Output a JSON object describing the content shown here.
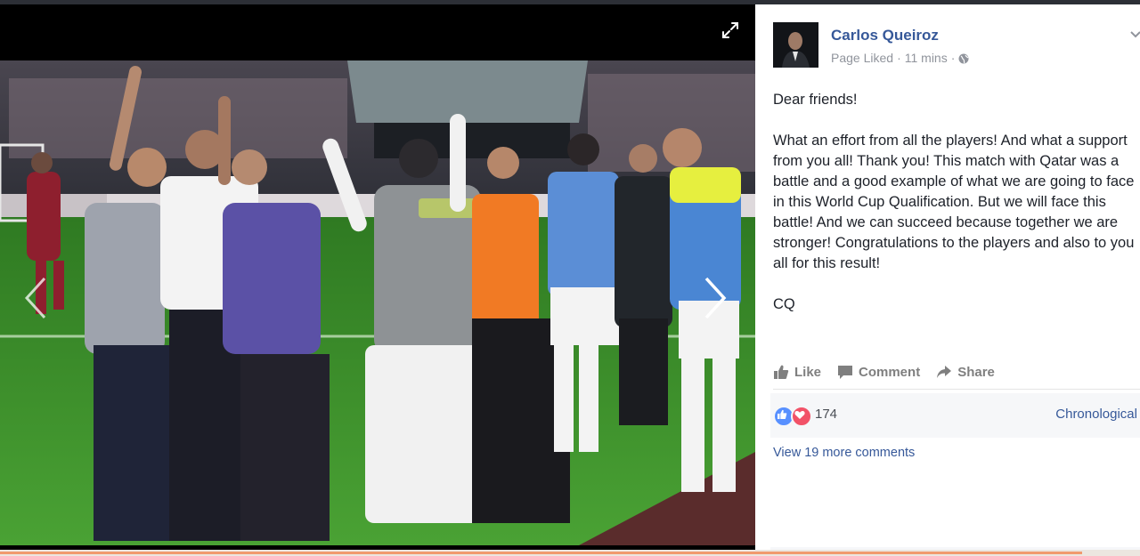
{
  "post": {
    "author": "Carlos Queiroz",
    "meta_liked": "Page Liked",
    "meta_sep": "·",
    "meta_time": "11 mins",
    "paragraphs": [
      "Dear friends!",
      "What an effort from all the players! And what a support from you all! Thank you! This match with Qatar was a battle and a good example of what we are going to face in this World Cup Qualification. But we will face this battle! And we can succeed because together we are stronger! Congratulations to the players and also to you all for this result!",
      "CQ"
    ]
  },
  "actions": {
    "like": "Like",
    "comment": "Comment",
    "share": "Share"
  },
  "reactions": {
    "count": "174",
    "sort_label": "Chronological"
  },
  "comments": {
    "view_more": "View 19 more comments"
  },
  "colors": {
    "link_blue": "#365899",
    "like_blue": "#5890ff",
    "love_red": "#f25268",
    "pitch_green": "#3f8f2c",
    "team_red": "#8e1f2e"
  },
  "icons": {
    "expand": "expand-icon",
    "prev": "chevron-left-icon",
    "next": "chevron-right-icon",
    "globe": "globe-icon",
    "menu": "chevron-down-icon",
    "like": "thumbs-up-icon",
    "comment": "comment-icon",
    "share": "share-arrow-icon"
  }
}
